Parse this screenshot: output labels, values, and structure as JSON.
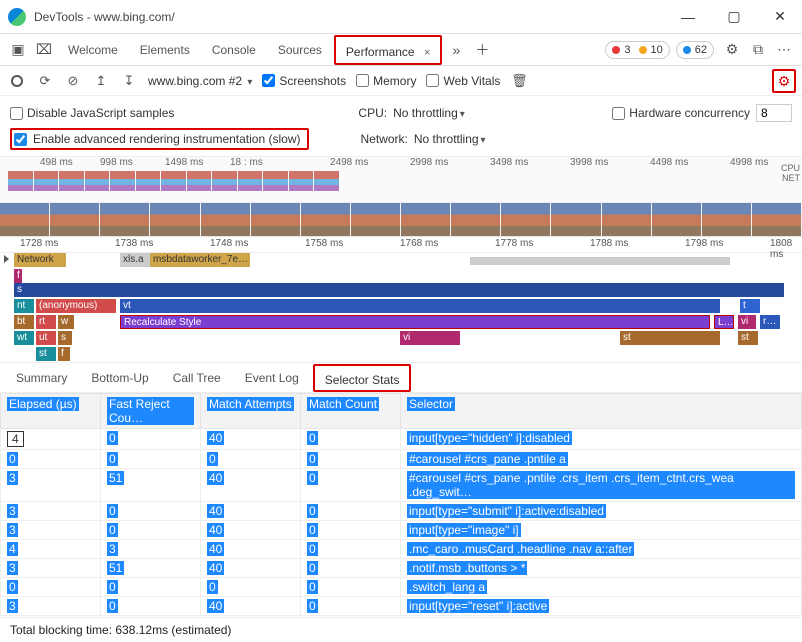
{
  "window": {
    "title": "DevTools - www.bing.com/"
  },
  "tabs": {
    "items": [
      "Welcome",
      "Elements",
      "Console",
      "Sources",
      "Performance"
    ],
    "active_close": "×"
  },
  "counts": {
    "errors": "3",
    "warnings": "10",
    "info": "62"
  },
  "perfbar": {
    "recording_select": "www.bing.com #2",
    "screenshots": "Screenshots",
    "memory": "Memory",
    "webvitals": "Web Vitals"
  },
  "settings": {
    "disable_js": "Disable JavaScript samples",
    "adv_render": "Enable advanced rendering instrumentation (slow)",
    "cpu_label": "CPU:",
    "cpu_value": "No throttling",
    "net_label": "Network:",
    "net_value": "No throttling",
    "hw_label": "Hardware concurrency",
    "hw_value": "8"
  },
  "overview_ticks": [
    "498 ms",
    "998 ms",
    "1498 ms",
    "18  : ms",
    "2498 ms",
    "2998 ms",
    "3498 ms",
    "3998 ms",
    "4498 ms",
    "4998 ms"
  ],
  "overview_labels": {
    "cpu": "CPU",
    "net": "NET"
  },
  "ruler2": [
    "1728 ms",
    "1738 ms",
    "1748 ms",
    "1758 ms",
    "1768 ms",
    "1778 ms",
    "1788 ms",
    "1798 ms",
    "1808 ms"
  ],
  "flame": {
    "network": "Network",
    "xls": "xls.a",
    "msb": "msbdataworker_7e…",
    "s": "s",
    "f": "f",
    "nt": "nt",
    "anon": "(anonymous)",
    "vt": "vt",
    "t": "t",
    "bt": "bt",
    "rt": "rt",
    "w": "w",
    "recalc": "Recalculate Style",
    "L": "L…",
    "vi": "vi",
    "r": "r…",
    "wt": "wt",
    "ut": "ut",
    "st": "st",
    "st2": "st"
  },
  "bottom_tabs": [
    "Summary",
    "Bottom-Up",
    "Call Tree",
    "Event Log",
    "Selector Stats"
  ],
  "table": {
    "headers": [
      "Elapsed (µs)",
      "Fast Reject Cou…",
      "Match Attempts",
      "Match Count",
      "Selector"
    ],
    "rows": [
      {
        "e": "4",
        "f": "0",
        "m": "40",
        "c": "0",
        "s": "input[type=\"hidden\" i]:disabled"
      },
      {
        "e": "0",
        "f": "0",
        "m": "0",
        "c": "0",
        "s": "#carousel #crs_pane .pntile a"
      },
      {
        "e": "3",
        "f": "51",
        "m": "40",
        "c": "0",
        "s": "#carousel #crs_pane .pntile .crs_item .crs_item_ctnt.crs_wea .deg_swit…"
      },
      {
        "e": "3",
        "f": "0",
        "m": "40",
        "c": "0",
        "s": "input[type=\"submit\" i]:active:disabled"
      },
      {
        "e": "3",
        "f": "0",
        "m": "40",
        "c": "0",
        "s": "input[type=\"image\" i]"
      },
      {
        "e": "4",
        "f": "3",
        "m": "40",
        "c": "0",
        "s": ".mc_caro .musCard .headline .nav a::after"
      },
      {
        "e": "3",
        "f": "51",
        "m": "40",
        "c": "0",
        "s": ".notif.msb .buttons > *"
      },
      {
        "e": "0",
        "f": "0",
        "m": "0",
        "c": "0",
        "s": ".switch_lang a"
      },
      {
        "e": "3",
        "f": "0",
        "m": "40",
        "c": "0",
        "s": "input[type=\"reset\" i]:active"
      }
    ]
  },
  "status": "Total blocking time: 638.12ms (estimated)"
}
